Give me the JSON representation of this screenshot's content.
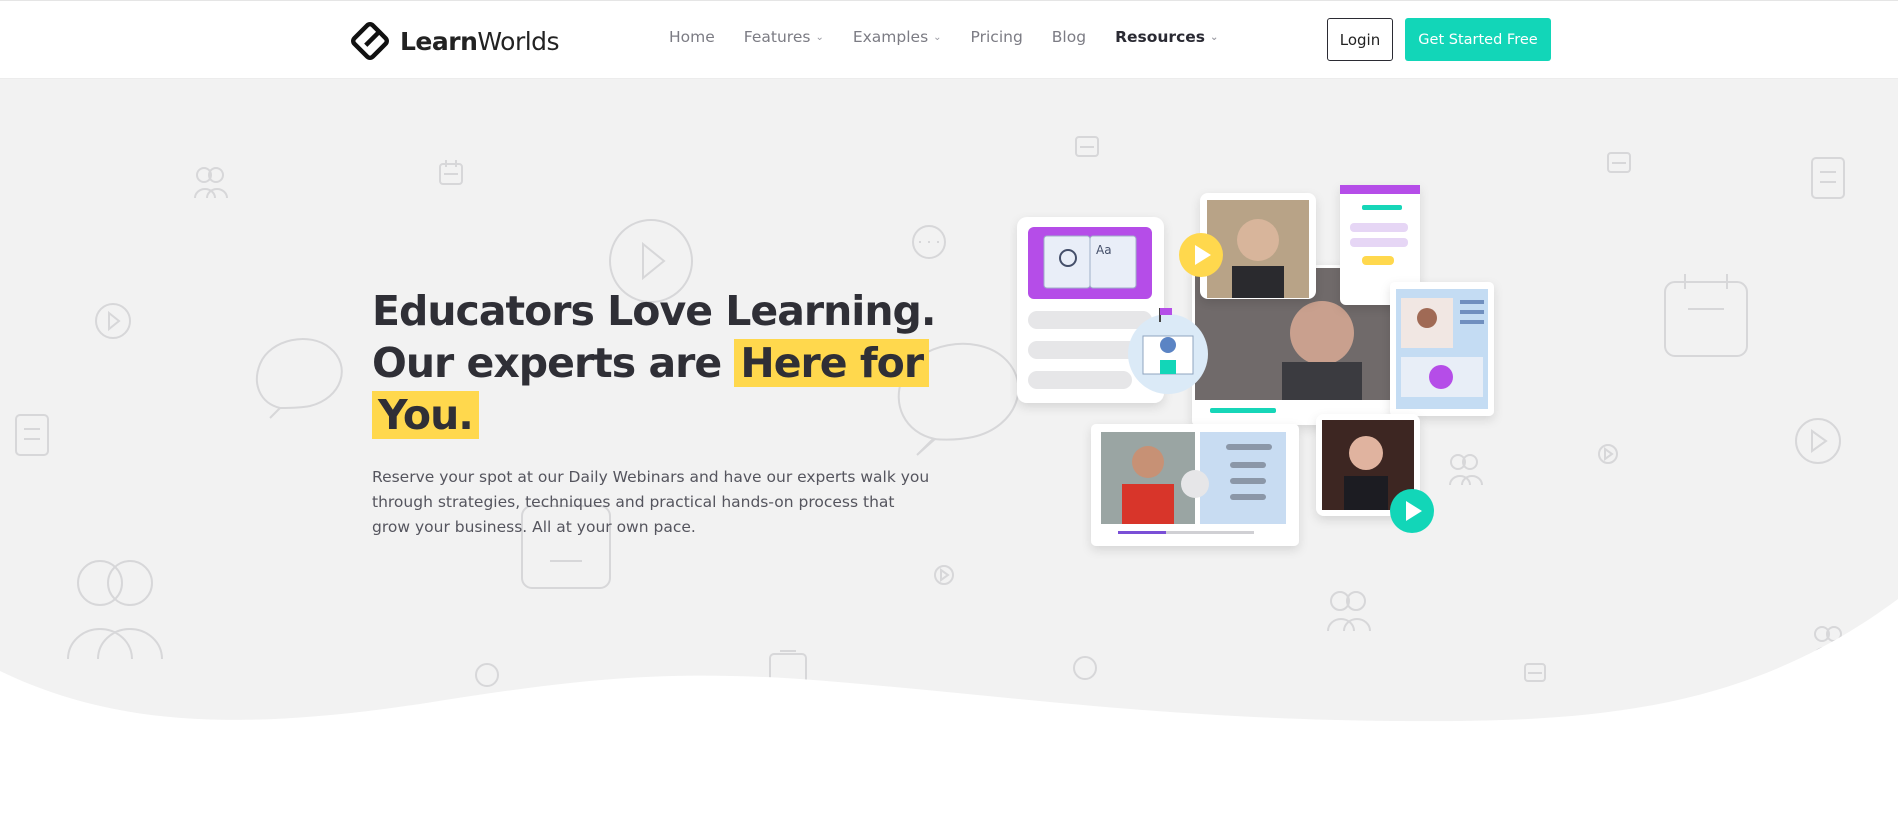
{
  "header": {
    "logo_text_bold": "Learn",
    "logo_text_rest": "Worlds",
    "nav": [
      {
        "label": "Home",
        "dropdown": false,
        "active": false
      },
      {
        "label": "Features",
        "dropdown": true,
        "active": false
      },
      {
        "label": "Examples",
        "dropdown": true,
        "active": false
      },
      {
        "label": "Pricing",
        "dropdown": false,
        "active": false
      },
      {
        "label": "Blog",
        "dropdown": false,
        "active": false
      },
      {
        "label": "Resources",
        "dropdown": true,
        "active": true
      }
    ],
    "login_label": "Login",
    "cta_label": "Get Started Free"
  },
  "hero": {
    "line1": "Educators Love Learning.",
    "line2_plain": "Our experts are ",
    "line2_highlight": "Here for",
    "line3_highlight": "You.",
    "subtitle": "Reserve your spot at our Daily Webinars and have our experts walk you through strategies, techniques and practical hands-on process that grow your business. All at your own pace."
  },
  "colors": {
    "accent_teal": "#12d6b8",
    "highlight_yellow": "#ffd84d",
    "purple": "#b54ee8",
    "hero_bg": "#f2f2f2"
  },
  "icons": [
    "learnworlds-logo-icon",
    "chevron-down-icon",
    "play-icon",
    "calendar-icon",
    "chat-bubble-icon",
    "users-icon",
    "clipboard-icon",
    "book-icon",
    "school-icon"
  ]
}
